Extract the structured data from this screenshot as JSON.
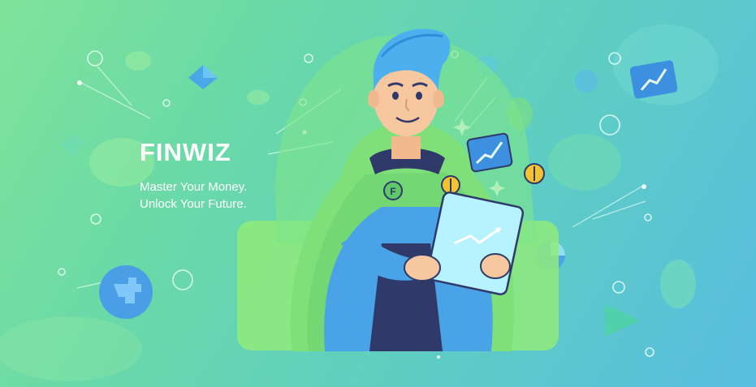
{
  "brand": {
    "name": "FINWIZ",
    "tagline_line1": "Master Your Money.",
    "tagline_line2": "Unlock Your Future."
  },
  "colors": {
    "background_start": "#7fe39a",
    "background_end": "#58bde0",
    "hoodie": "#4aa3e6",
    "cape": "#7fe07a",
    "hair": "#4cb0ef",
    "coin": "#f2c230"
  },
  "icons": [
    "chart-up-icon",
    "coin-icon",
    "sparkle-icon",
    "pie-chart-icon",
    "play-icon",
    "puzzle-icon",
    "diamond-icon"
  ]
}
